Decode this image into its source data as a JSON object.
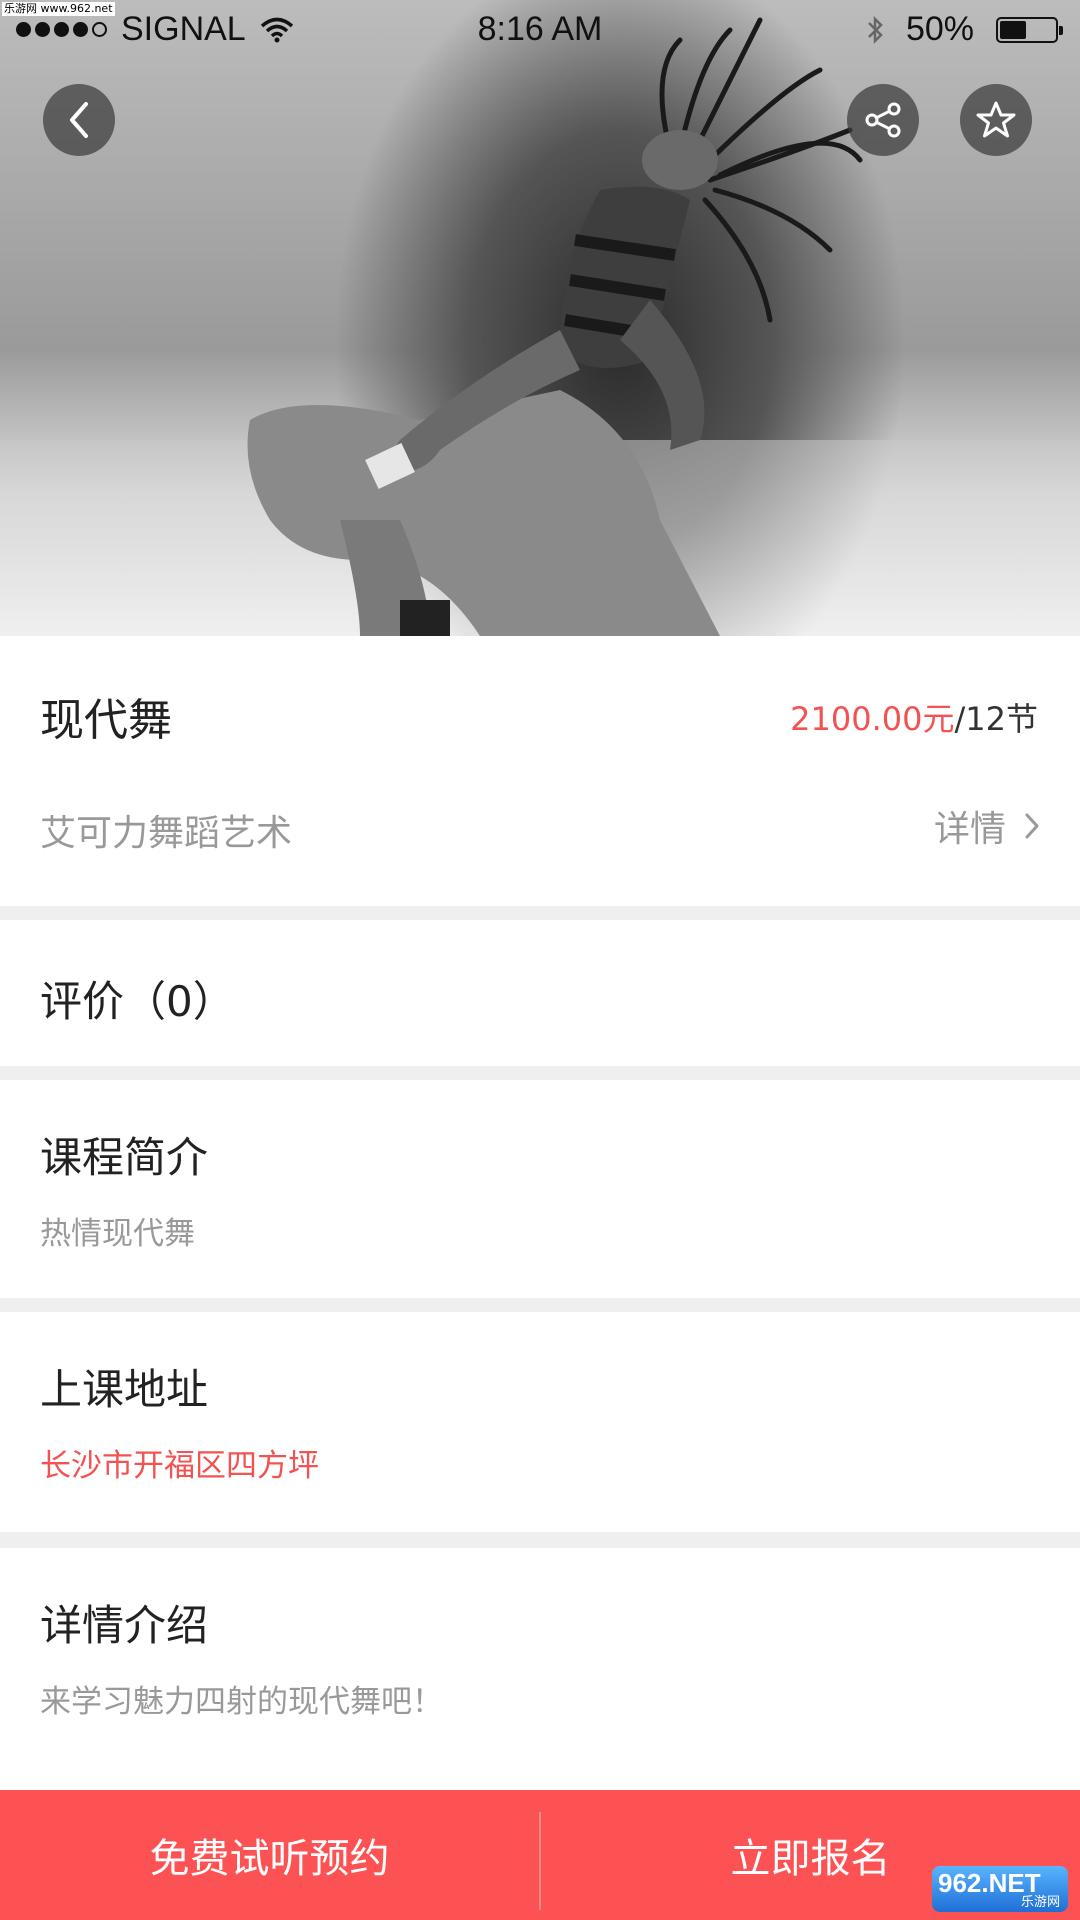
{
  "status_bar": {
    "carrier": "SIGNAL",
    "time": "8:16 AM",
    "battery": "50%",
    "battery_level": 0.5
  },
  "watermark_top": "乐游网 www.962.net",
  "header": {
    "back_icon": "chevron-left-icon",
    "share_icon": "share-icon",
    "favorite_icon": "star-icon"
  },
  "course": {
    "title": "现代舞",
    "price_amount": "2100.00元",
    "price_unit": "/12节",
    "org_name": "艾可力舞蹈艺术",
    "detail_label": "详情"
  },
  "reviews": {
    "label": "评价（0）"
  },
  "intro": {
    "title": "课程简介",
    "body": "热情现代舞"
  },
  "address": {
    "title": "上课地址",
    "body": "长沙市开福区四方坪"
  },
  "details": {
    "title": "详情介绍",
    "body": "来学习魅力四射的现代舞吧！"
  },
  "actions": {
    "trial_label": "免费试听预约",
    "enroll_label": "立即报名"
  },
  "watermark_logo": {
    "text": "962.NET",
    "sub": "乐游网"
  },
  "colors": {
    "accent": "#f35252",
    "button_bar": "#fd5254"
  }
}
